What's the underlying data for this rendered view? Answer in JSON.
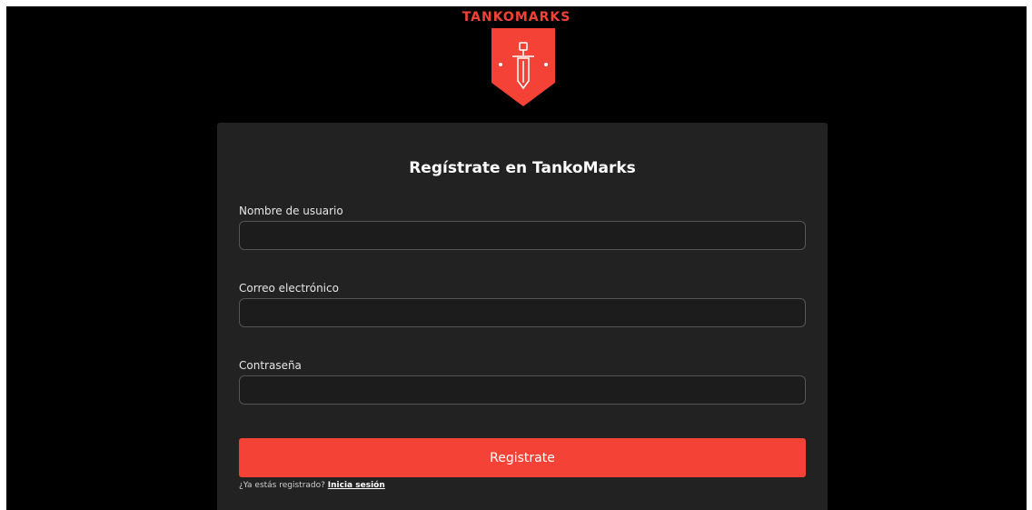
{
  "brand": {
    "name": "TANKOMARKS",
    "accent": "#f44336",
    "logo_icon": "sword-shield-icon"
  },
  "form": {
    "title": "Regístrate en TankoMarks",
    "fields": [
      {
        "label": "Nombre de usuario",
        "value": "",
        "placeholder": ""
      },
      {
        "label": "Correo electrónico",
        "value": "",
        "placeholder": ""
      },
      {
        "label": "Contraseña",
        "value": "",
        "placeholder": ""
      }
    ],
    "submit_label": "Registrate",
    "signin_prompt": "¿Ya estás registrado?",
    "signin_link": "Inicia sesión"
  },
  "colors": {
    "background": "#000000",
    "card": "#222222",
    "input_border": "#555555",
    "button": "#f44336"
  }
}
